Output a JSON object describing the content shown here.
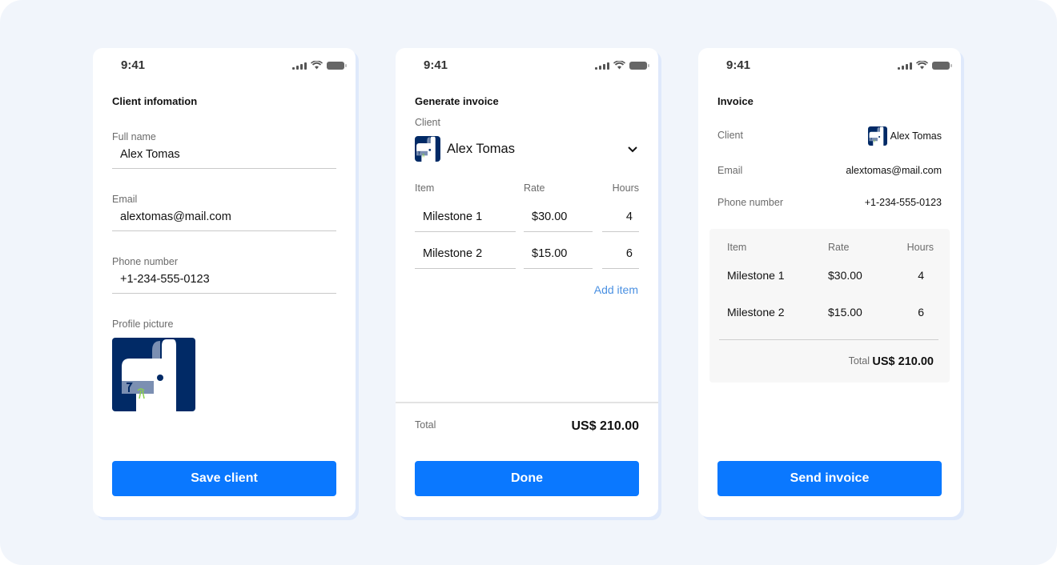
{
  "status_bar": {
    "time": "9:41"
  },
  "colors": {
    "primary": "#0a78ff",
    "avatar_bg": "#012a66",
    "link": "#4a90e2",
    "background": "#f1f5fb"
  },
  "client_screen": {
    "title": "Client infomation",
    "fields": [
      {
        "label": "Full name",
        "value": "Alex Tomas"
      },
      {
        "label": "Email",
        "value": "alextomas@mail.com"
      },
      {
        "label": "Phone number",
        "value": "+1-234-555-0123"
      }
    ],
    "profile_picture_label": "Profile picture",
    "save_button": "Save client"
  },
  "generate_screen": {
    "title": "Generate invoice",
    "client_label": "Client",
    "client_name": "Alex Tomas",
    "columns": {
      "item": "Item",
      "rate": "Rate",
      "hours": "Hours"
    },
    "items": [
      {
        "item": "Milestone 1",
        "rate": "$30.00",
        "hours": "4"
      },
      {
        "item": "Milestone 2",
        "rate": "$15.00",
        "hours": "6"
      }
    ],
    "add_item": "Add item",
    "total_label": "Total",
    "total_value": "US$ 210.00",
    "done_button": "Done"
  },
  "invoice_screen": {
    "title": "Invoice",
    "client_label": "Client",
    "client_name": "Alex Tomas",
    "email_label": "Email",
    "email_value": "alextomas@mail.com",
    "phone_label": "Phone number",
    "phone_value": "+1-234-555-0123",
    "columns": {
      "item": "Item",
      "rate": "Rate",
      "hours": "Hours"
    },
    "items": [
      {
        "item": "Milestone 1",
        "rate": "$30.00",
        "hours": "4"
      },
      {
        "item": "Milestone 2",
        "rate": "$15.00",
        "hours": "6"
      }
    ],
    "total_label": "Total",
    "total_value": "US$ 210.00",
    "send_button": "Send invoice"
  }
}
